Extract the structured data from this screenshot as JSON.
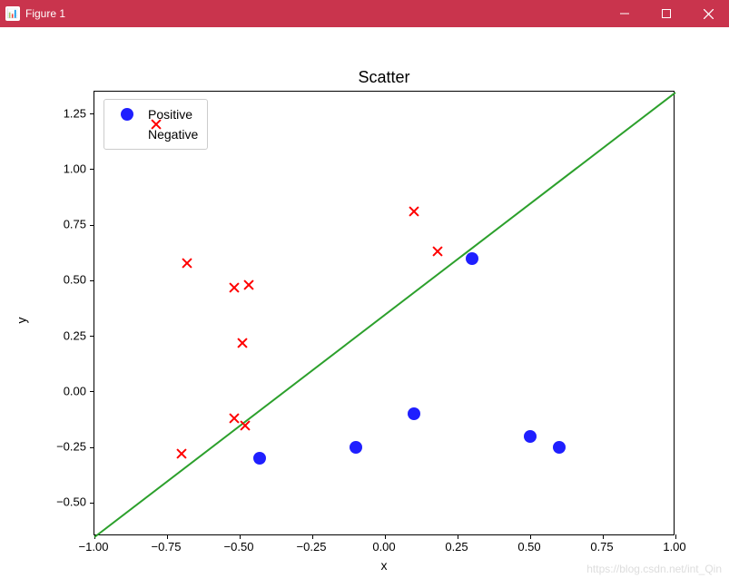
{
  "window": {
    "title": "Figure 1"
  },
  "chart_data": {
    "type": "scatter",
    "title": "Scatter",
    "xlabel": "x",
    "ylabel": "y",
    "xlim": [
      -1.0,
      1.0
    ],
    "ylim": [
      -0.65,
      1.35
    ],
    "xticks": [
      "−1.00",
      "−0.75",
      "−0.50",
      "−0.25",
      "0.00",
      "0.25",
      "0.50",
      "0.75",
      "1.00"
    ],
    "yticks": [
      "−0.50",
      "−0.25",
      "0.00",
      "0.25",
      "0.50",
      "0.75",
      "1.00",
      "1.25"
    ],
    "series": [
      {
        "name": "Positive",
        "marker": "circle",
        "color": "#1f1fff",
        "points": [
          {
            "x": 0.3,
            "y": 0.6
          },
          {
            "x": -0.43,
            "y": -0.3
          },
          {
            "x": -0.1,
            "y": -0.25
          },
          {
            "x": 0.1,
            "y": -0.1
          },
          {
            "x": 0.5,
            "y": -0.2
          },
          {
            "x": 0.6,
            "y": -0.25
          }
        ]
      },
      {
        "name": "Negative",
        "marker": "x",
        "color": "#ff0000",
        "points": [
          {
            "x": -0.68,
            "y": 0.58
          },
          {
            "x": -0.52,
            "y": 0.47
          },
          {
            "x": -0.47,
            "y": 0.48
          },
          {
            "x": -0.49,
            "y": 0.22
          },
          {
            "x": -0.52,
            "y": -0.12
          },
          {
            "x": -0.48,
            "y": -0.15
          },
          {
            "x": -0.7,
            "y": -0.28
          },
          {
            "x": 0.1,
            "y": 0.81
          },
          {
            "x": 0.18,
            "y": 0.63
          }
        ]
      }
    ],
    "line": {
      "x1": -1.0,
      "y1": -0.65,
      "x2": 1.0,
      "y2": 1.35,
      "color": "#2ca02c"
    },
    "legend": {
      "position": "upper-left"
    }
  },
  "watermark": "https://blog.csdn.net/int_Qin"
}
